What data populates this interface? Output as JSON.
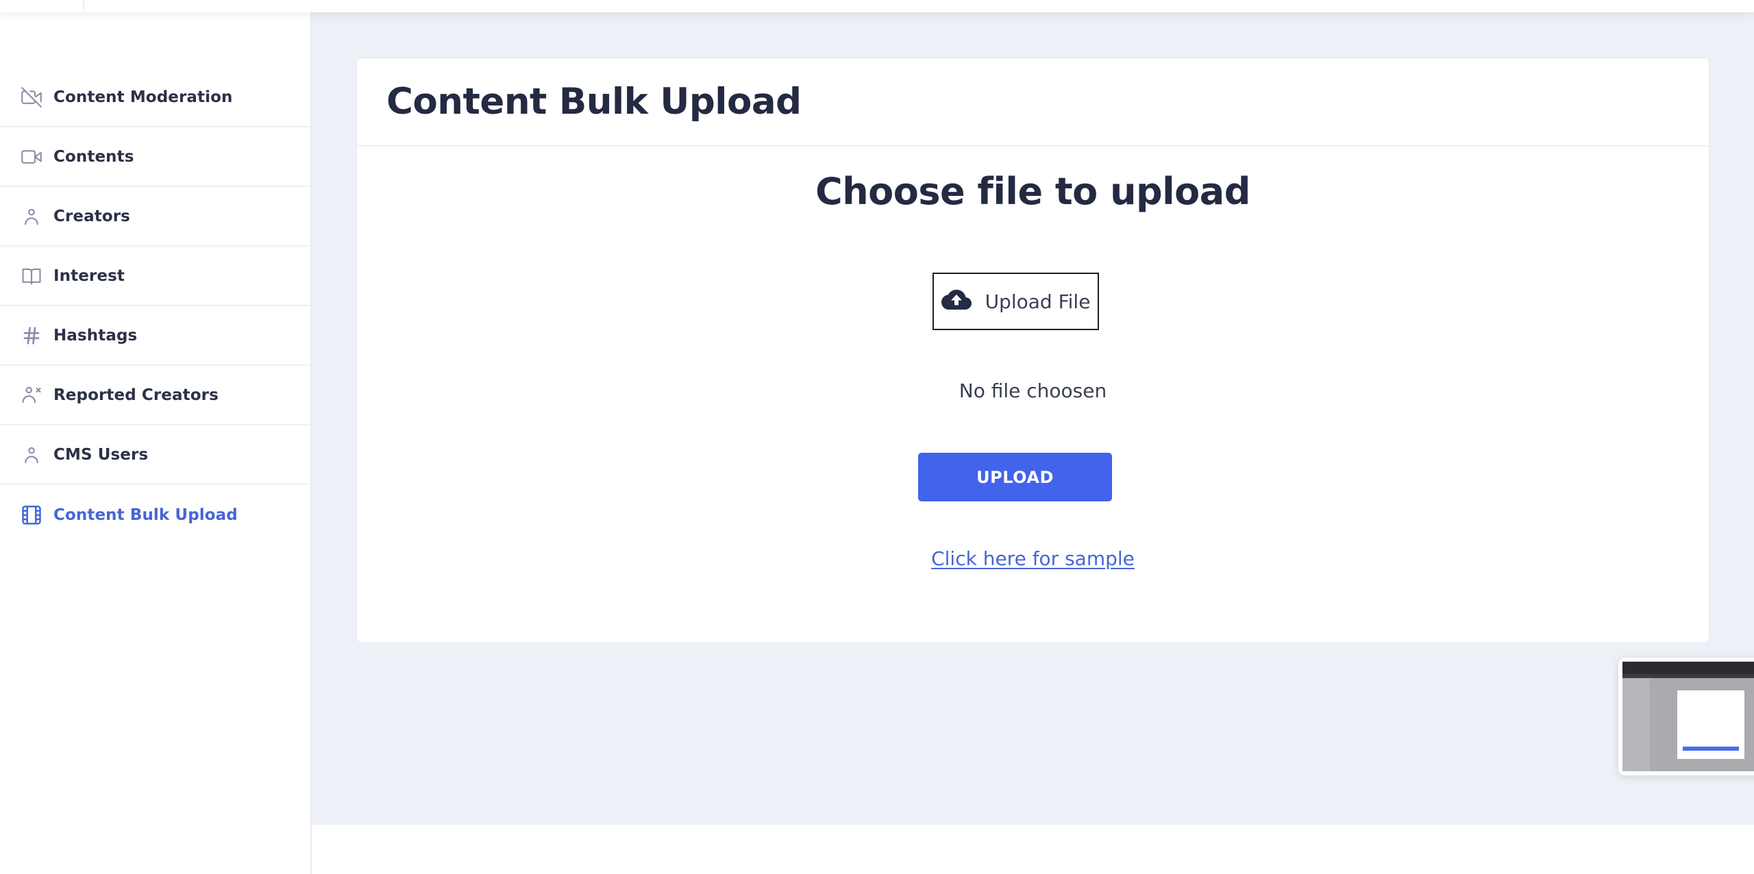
{
  "sidebar": {
    "items": [
      {
        "label": "Content Moderation",
        "icon": "video-off-icon",
        "active": false
      },
      {
        "label": "Contents",
        "icon": "video-icon",
        "active": false
      },
      {
        "label": "Creators",
        "icon": "user-icon",
        "active": false
      },
      {
        "label": "Interest",
        "icon": "book-open-icon",
        "active": false
      },
      {
        "label": "Hashtags",
        "icon": "hash-icon",
        "active": false
      },
      {
        "label": "Reported Creators",
        "icon": "user-x-icon",
        "active": false
      },
      {
        "label": "CMS Users",
        "icon": "user-icon",
        "active": false
      },
      {
        "label": "Content Bulk Upload",
        "icon": "film-icon",
        "active": true
      }
    ]
  },
  "main": {
    "title": "Content Bulk Upload",
    "section_title": "Choose file to upload",
    "upload_file_label": "Upload File",
    "upload_file_icon": "cloud-upload-icon",
    "file_status": "No file choosen",
    "upload_button_label": "UPLOAD",
    "sample_link_label": "Click here for sample"
  },
  "colors": {
    "accent": "#4263eb",
    "active_nav": "#4566d6",
    "text_dark": "#232a42",
    "background": "#edf0f7"
  },
  "thumbnail": {
    "icon": "screenshot-preview"
  }
}
